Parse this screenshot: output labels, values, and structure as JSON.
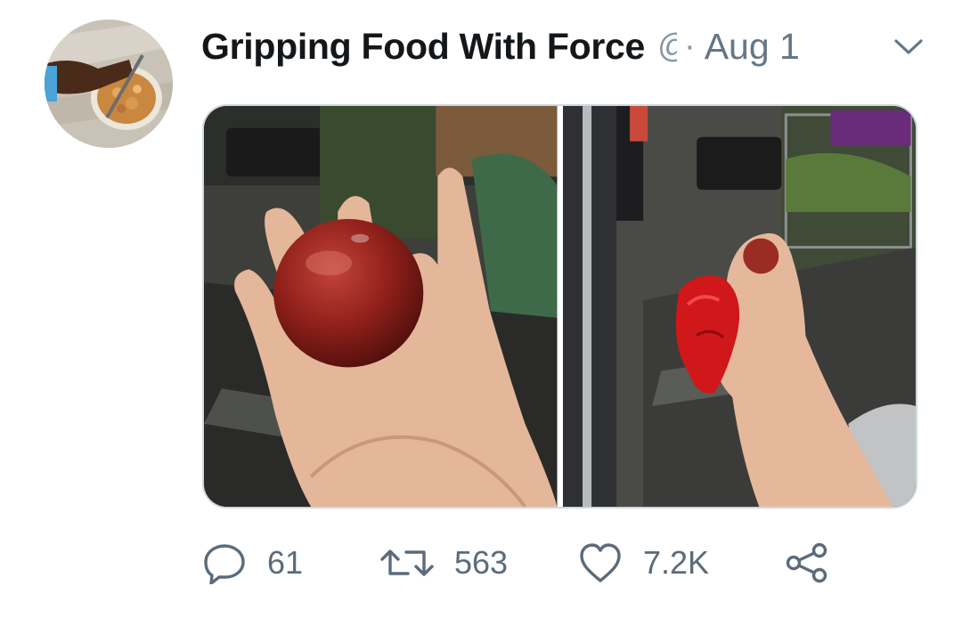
{
  "tweet": {
    "author_name": "Gripping Food With Force",
    "handle_fragment": "@",
    "separator": "·",
    "date": "Aug 1"
  },
  "actions": {
    "reply_count": "61",
    "retweet_count": "563",
    "like_count": "7.2K"
  },
  "icons": {
    "reply": "reply-icon",
    "retweet": "retweet-icon",
    "like": "heart-icon",
    "share": "share-icon",
    "more": "chevron-down-icon"
  },
  "colors": {
    "text_primary": "#14171a",
    "text_secondary": "#657786",
    "icon": "#5b6b7a"
  }
}
